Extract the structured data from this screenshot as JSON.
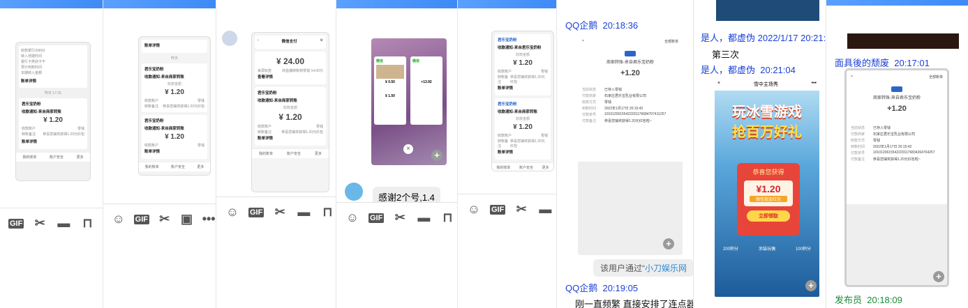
{
  "toolbar": {
    "gif": "GIF",
    "emoji": "☺",
    "scissors": "✂",
    "folder": "▬",
    "image": "▣",
    "more": "•••",
    "tool": "⊓"
  },
  "p1": {
    "top_lines": [
      "收款银行(5869)",
      "转入地建时间",
      "银行卡类别卡不",
      "预计到账时间",
      "本期转入金额"
    ],
    "menu1": "账单详情",
    "date_sep": "昨天 17:25",
    "mini_title": "君乐宝奶粉",
    "mini_subtitle": "收款通知-来自商家转账",
    "amount": "¥ 1.20",
    "rows": [
      [
        "收款账户",
        "零钱"
      ],
      [
        "转账备注",
        "恭喜您抽奖获得1.20元红包"
      ]
    ],
    "detail": "账单详情",
    "nav": [
      "我的账单",
      "账户安全",
      "更多"
    ]
  },
  "p2": {
    "header": "账单详情",
    "sep": "昨天",
    "card_a_title": "收款通知-来自商家转账",
    "card_a_amount_label": "收款金额",
    "amount": "¥ 1.20",
    "rows": [
      [
        "收款账户",
        "零钱"
      ],
      [
        "转账备注",
        "恭喜您抽奖获得1.20元红包"
      ]
    ],
    "detail": "账单详情",
    "brand": "君乐宝奶粉",
    "nav": [
      "我的账单",
      "账户安全",
      "更多"
    ]
  },
  "p3": {
    "title": "微信支付",
    "amount_big": "¥ 24.00",
    "row_label": "来源标签",
    "row_value": "商盈播转账到零钱 14.00元",
    "view_detail": "查看详情",
    "brand": "君乐宝奶粉",
    "notice": "收款通知-来自商家转账",
    "amount_label": "收款金额",
    "amount": "¥ 1.20",
    "rows": [
      [
        "收款账户",
        "零钱"
      ],
      [
        "转账备注",
        "恭喜您抽奖获得1.20元红包"
      ]
    ],
    "detail": "账单详情",
    "nav": [
      "我的账单",
      "账户安全",
      "更多"
    ]
  },
  "p4": {
    "app_a": "微信",
    "app_b": "微信",
    "amounts": [
      "¥ 0.50",
      "+13.92",
      "¥ 1.50"
    ],
    "message": "感谢2个号,1.4"
  },
  "p5": {
    "brand": "君乐宝奶粉",
    "notice_a": "收款通知-来自君乐宝奶粉",
    "notice_b": "收款通知-来自商家转账",
    "amount_label": "收款金额",
    "amount": "¥ 1.20",
    "rows": [
      [
        "收款账户",
        "零钱"
      ],
      [
        "转账备注",
        "恭喜您抽奖获得1.20元红包"
      ]
    ],
    "detail": "账单详情",
    "nav": [
      "我的账单",
      "账户安全",
      "更多"
    ]
  },
  "p6": {
    "sender_a": "QQ企鹅",
    "time_a": "20:18:36",
    "top_right": "全部账单",
    "title": "商家转账-来自君乐宝奶粉",
    "amount": "+1.20",
    "rows": [
      [
        "当前状态",
        "已存入零钱"
      ],
      [
        "付款商家",
        "石家庄君乐宝乳业有限公司"
      ],
      [
        "收款方式",
        "零钱"
      ],
      [
        "到账时间",
        "2022年1月17日 20:15:42"
      ],
      [
        "付款单号",
        "10101206155422201176684707411257"
      ],
      [
        "付款备注",
        "恭喜您抽奖获得1.20元红包啦~"
      ]
    ],
    "system_prefix": "该用户通过“",
    "system_link": "小刀娱乐网",
    "sender_b": "QQ企鹅",
    "time_b": "20:19:05",
    "message_b": "刚一直频繁  直接安排了连点器"
  },
  "p7": {
    "sender_a": "是人，都虚伪",
    "time_a": "2022/1/17 20:21:0",
    "message_a": "第三次",
    "sender_b": "是人，都虚伪",
    "time_b": "20:21:04",
    "game_title": "雪中主场秀",
    "banner_line1": "玩冰雪游戏",
    "banner_line2": "抢百万好礼",
    "popup_title": "恭喜您获得",
    "popup_amount": "¥1.20",
    "popup_sub": "微信现金红包",
    "popup_btn": "立即领取",
    "tiles": [
      "200积分",
      "涂装玩偶",
      "100积分"
    ]
  },
  "p8": {
    "sender_a": "面具後的颓废",
    "time_a": "20:17:01",
    "top_right": "全部账单",
    "title": "商家转账-来自君乐宝奶粉",
    "amount": "+1.20",
    "rows": [
      [
        "当前状态",
        "已存入零钱"
      ],
      [
        "付款商家",
        "石家庄君乐宝乳业有限公司"
      ],
      [
        "收款方式",
        "零钱"
      ],
      [
        "到账时间",
        "2022年1月17日 20:15:42"
      ],
      [
        "付款单号",
        "10101206155422201176834264764257"
      ],
      [
        "付款备注",
        "恭喜您抽奖获得1.20元红包啦~"
      ]
    ],
    "sender_b": "发布员",
    "time_b": "20:18:09"
  }
}
